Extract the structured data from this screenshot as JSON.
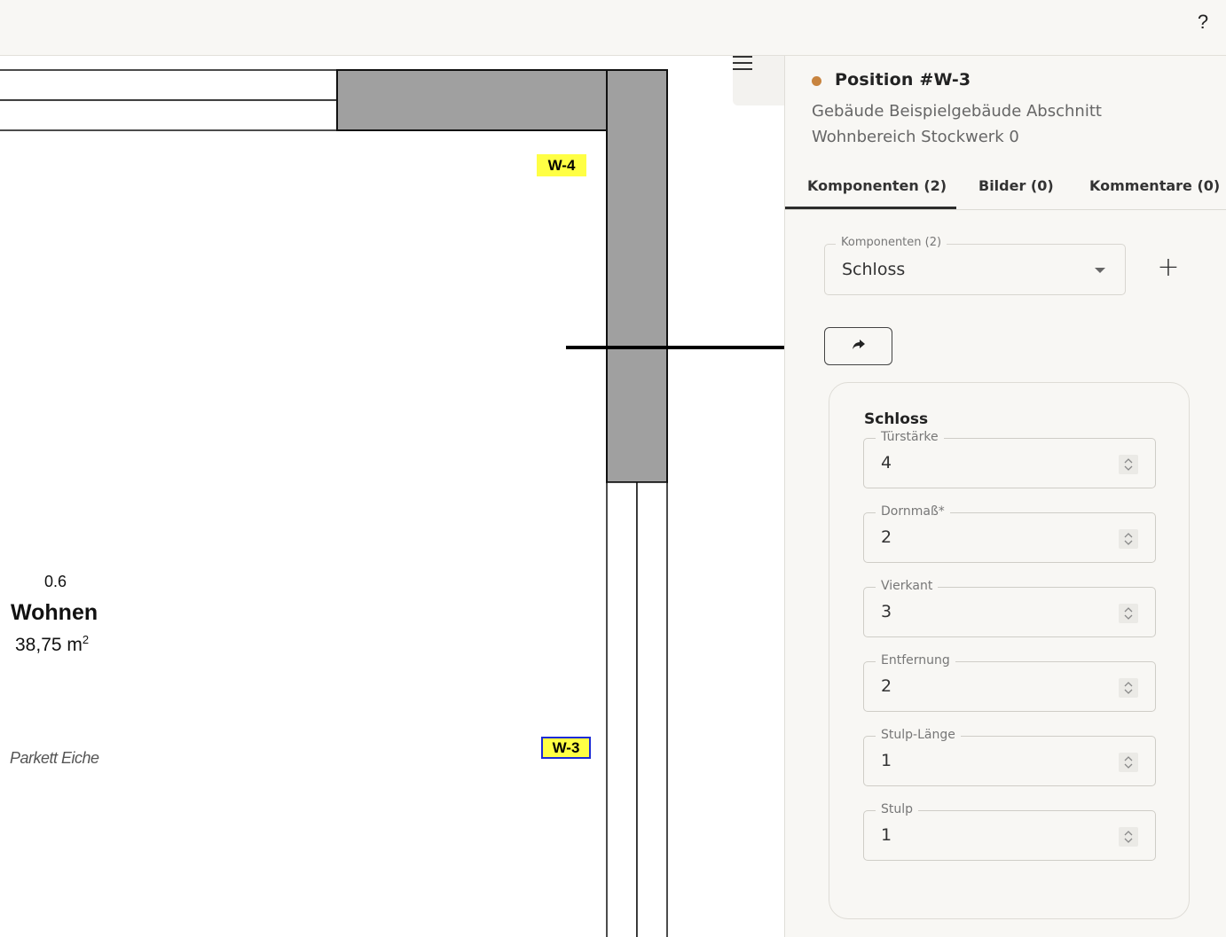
{
  "header": {
    "help_label": "?"
  },
  "plan": {
    "room_number": "0.6",
    "room_name": "Wohnen",
    "room_area": "38,75 m",
    "room_area_unit_sup": "2",
    "floor_type": "Parkett Eiche",
    "tags": [
      {
        "label": "W-4",
        "selected": false
      },
      {
        "label": "W-3",
        "selected": true
      }
    ],
    "colors": {
      "wall_fill": "#a0a0a0",
      "tag_fill": "#ffff44",
      "selected_border": "#1c2bd6"
    }
  },
  "panel": {
    "title": "Position #W-3",
    "status_color": "#c8843f",
    "subtitle": "Gebäude Beispielgebäude Abschnitt Wohnbereich Stockwerk 0",
    "tabs": [
      {
        "label": "Komponenten (2)",
        "active": true
      },
      {
        "label": "Bilder (0)",
        "active": false
      },
      {
        "label": "Kommentare (0)",
        "active": false
      }
    ],
    "component_select": {
      "label": "Komponenten (2)",
      "value": "Schloss"
    },
    "add_label": "+",
    "component": {
      "title": "Schloss",
      "fields": [
        {
          "label": "Türstärke",
          "value": "4"
        },
        {
          "label": "Dornmaß*",
          "value": "2"
        },
        {
          "label": "Vierkant",
          "value": "3"
        },
        {
          "label": "Entfernung",
          "value": "2"
        },
        {
          "label": "Stulp-Länge",
          "value": "1"
        },
        {
          "label": "Stulp",
          "value": "1"
        }
      ]
    }
  }
}
